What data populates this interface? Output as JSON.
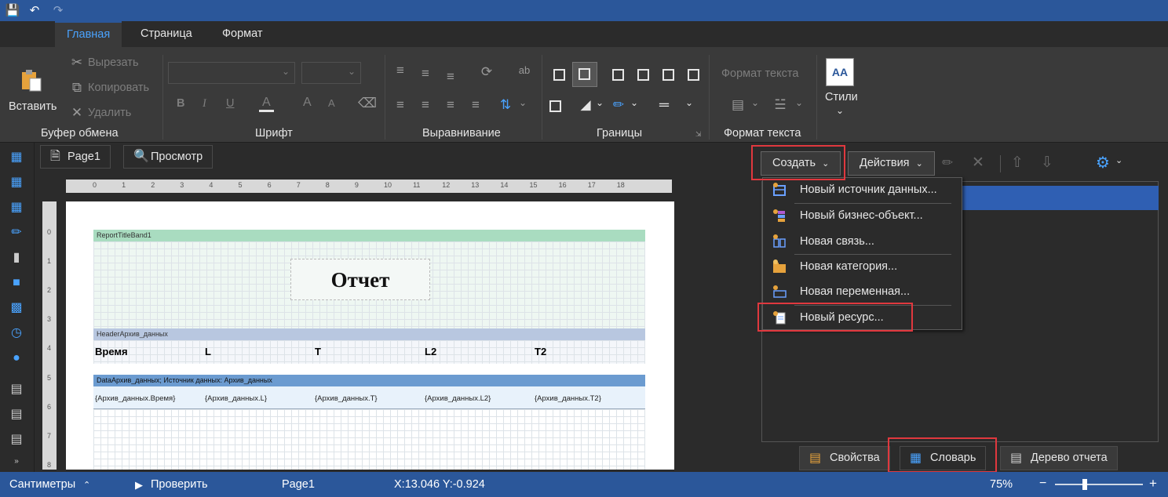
{
  "ribbon": {
    "tabs": [
      "Главная",
      "Страница",
      "Формат"
    ],
    "clipboard": {
      "paste": "Вставить",
      "cut": "Вырезать",
      "copy": "Копировать",
      "delete": "Удалить",
      "label": "Буфер обмена"
    },
    "font": {
      "label": "Шрифт",
      "bold": "B",
      "italic": "I",
      "underline": "U",
      "color": "A",
      "grow": "A",
      "shrink": "A"
    },
    "align": {
      "label": "Выравнивание"
    },
    "borders": {
      "label": "Границы"
    },
    "textformat": {
      "title": "Формат текста",
      "label": "Формат текста"
    },
    "styles": {
      "label": "Стили",
      "icon": "AA"
    }
  },
  "page_tabs": {
    "page1": "Page1",
    "preview": "Просмотр"
  },
  "ruler": {
    "h": [
      "0",
      "1",
      "2",
      "3",
      "4",
      "5",
      "6",
      "7",
      "8",
      "9",
      "10",
      "11",
      "12",
      "13",
      "14",
      "15",
      "16",
      "17",
      "18"
    ],
    "v": [
      "0",
      "1",
      "2",
      "3",
      "4",
      "5",
      "6",
      "7",
      "8"
    ]
  },
  "report": {
    "title_band": "ReportTitleBand1",
    "title_text": "Отчет",
    "header_band": "HeaderАрхив_данных",
    "headers": [
      "Время",
      "L",
      "T",
      "L2",
      "T2"
    ],
    "data_band": "DataАрхив_данных; Источник данных: Архив_данных",
    "cells": [
      "{Архив_данных.Время}",
      "{Архив_данных.L}",
      "{Архив_данных.T}",
      "{Архив_данных.L2}",
      "{Архив_данных.T2}"
    ]
  },
  "dictionary": {
    "create": "Создать",
    "actions": "Действия",
    "menu": [
      "Новый источник данных...",
      "Новый бизнес-объект...",
      "Новая связь...",
      "Новая категория...",
      "Новая переменная...",
      "Новый ресурс..."
    ]
  },
  "bottom_tabs": {
    "properties": "Свойства",
    "dictionary": "Словарь",
    "report_tree": "Дерево отчета"
  },
  "status": {
    "units": "Сантиметры",
    "check": "Проверить",
    "page": "Page1",
    "coords": "X:13.046  Y:-0.924",
    "zoom": "75%",
    "zoom_level": 0.75
  },
  "colors": {
    "accent": "#2b579a",
    "highlight": "#e0383e",
    "title_band": "#a9dcc0",
    "header_band": "#b8c7e0",
    "data_band": "#6b9bd0"
  }
}
